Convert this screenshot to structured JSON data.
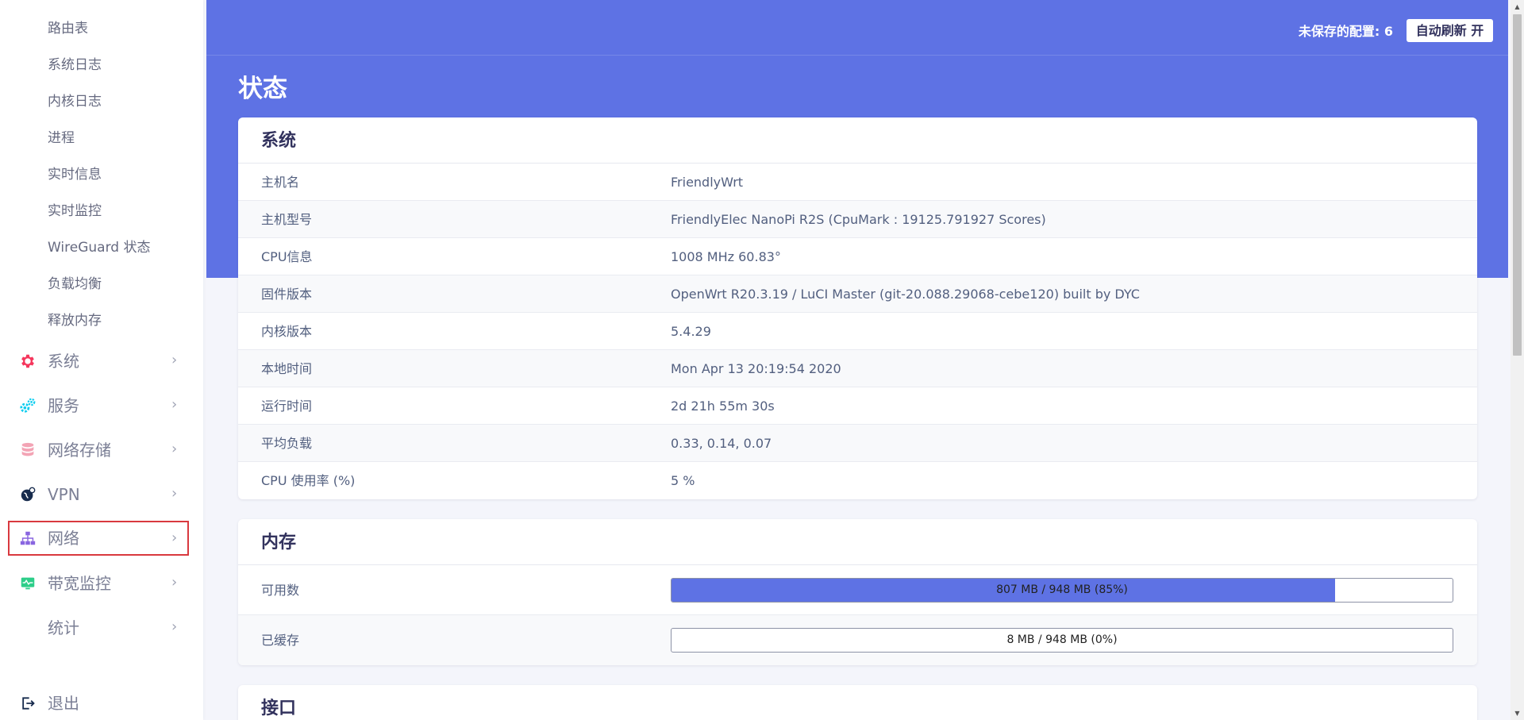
{
  "sidebar": {
    "sub_items": [
      "路由表",
      "系统日志",
      "内核日志",
      "进程",
      "实时信息",
      "实时监控",
      "WireGuard 状态",
      "负载均衡",
      "释放内存"
    ],
    "menu": [
      {
        "label": "系统",
        "icon": "gear-icon",
        "color": "#f5365c"
      },
      {
        "label": "服务",
        "icon": "cogs-icon",
        "color": "#11cdef"
      },
      {
        "label": "网络存储",
        "icon": "database-icon",
        "color": "#f3a4b5"
      },
      {
        "label": "VPN",
        "icon": "globe-icon",
        "color": "#172b4d"
      },
      {
        "label": "网络",
        "icon": "sitemap-icon",
        "color": "#8965e0"
      },
      {
        "label": "带宽监控",
        "icon": "monitor-icon",
        "color": "#2dce89"
      },
      {
        "label": "统计",
        "icon": "",
        "color": ""
      }
    ],
    "logout": "退出",
    "chevron": "›"
  },
  "header": {
    "unsaved": "未保存的配置: 6",
    "auto_refresh": "自动刷新 开"
  },
  "page": {
    "title": "状态"
  },
  "system": {
    "title": "系统",
    "rows": [
      {
        "k": "主机名",
        "v": "FriendlyWrt"
      },
      {
        "k": "主机型号",
        "v": "FriendlyElec NanoPi R2S (CpuMark : 19125.791927 Scores)"
      },
      {
        "k": "CPU信息",
        "v": "1008 MHz 60.83°"
      },
      {
        "k": "固件版本",
        "v": "OpenWrt R20.3.19 / LuCI Master (git-20.088.29068-cebe120) built by DYC"
      },
      {
        "k": "内核版本",
        "v": "5.4.29"
      },
      {
        "k": "本地时间",
        "v": "Mon Apr 13 20:19:54 2020"
      },
      {
        "k": "运行时间",
        "v": "2d 21h 55m 30s"
      },
      {
        "k": "平均负载",
        "v": "0.33, 0.14, 0.07"
      },
      {
        "k": "CPU 使用率 (%)",
        "v": "5 %"
      }
    ]
  },
  "memory": {
    "title": "内存",
    "rows": [
      {
        "k": "可用数",
        "text": "807 MB / 948 MB (85%)",
        "percent": 85
      },
      {
        "k": "已缓存",
        "text": "8 MB / 948 MB (0%)",
        "percent": 0
      }
    ]
  },
  "interface": {
    "title": "接口"
  },
  "colors": {
    "accent": "#5e72e4",
    "highlight": "#d9393f"
  }
}
